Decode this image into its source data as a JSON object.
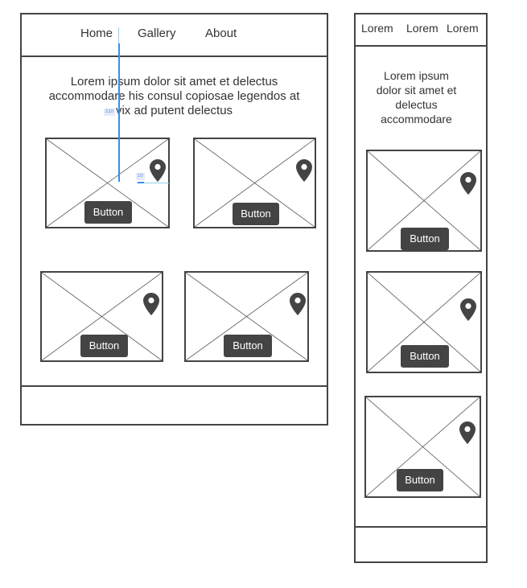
{
  "desktop": {
    "nav": [
      "Home",
      "Gallery",
      "About"
    ],
    "intro_lines": [
      "Lorem ipsum dolor sit amet et delectus",
      "accommodare his consul copiosae legendos at",
      "vix ad putent delectus"
    ],
    "cards": [
      {
        "button_label": "Button",
        "pin": "location-pin-icon"
      },
      {
        "button_label": "Button",
        "pin": "location-pin-icon"
      },
      {
        "button_label": "Button",
        "pin": "location-pin-icon"
      },
      {
        "button_label": "Button",
        "pin": "location-pin-icon"
      }
    ]
  },
  "mobile": {
    "nav": [
      "Lorem",
      "Lorem",
      "Lorem"
    ],
    "intro_lines": [
      "Lorem ipsum",
      "dolor sit amet et",
      "delectus",
      "accommodare"
    ],
    "cards": [
      {
        "button_label": "Button",
        "pin": "location-pin-icon"
      },
      {
        "button_label": "Button",
        "pin": "location-pin-icon"
      },
      {
        "button_label": "Button",
        "pin": "location-pin-icon"
      }
    ]
  },
  "annotations": {
    "distance_label": "210",
    "spacing_label": "10"
  },
  "colors": {
    "stroke": "#444444",
    "text": "#333333",
    "button_bg": "#444444",
    "button_text": "#ffffff",
    "guide": "#3a8ee6",
    "guide_light": "#8fd3f0"
  }
}
